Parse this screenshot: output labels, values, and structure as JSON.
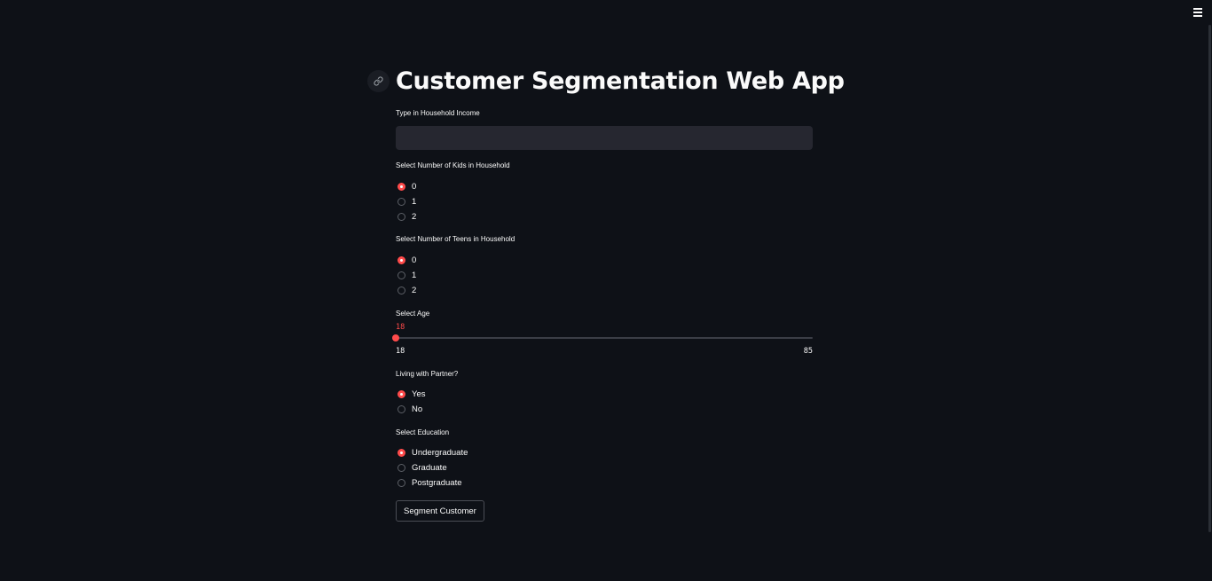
{
  "app": {
    "title": "Customer Segmentation Web App"
  },
  "icons": {
    "anchor": "link-icon",
    "menu": "hamburger-menu-icon"
  },
  "colors": {
    "background": "#0e1117",
    "accent": "#ff4b4b",
    "input_background": "#262730",
    "text": "#fafafa"
  },
  "income": {
    "label": "Type in Household Income",
    "value": "",
    "placeholder": ""
  },
  "kids": {
    "label": "Select Number of Kids in Household",
    "options": [
      "0",
      "1",
      "2"
    ],
    "selected": "0"
  },
  "teens": {
    "label": "Select Number of Teens in Household",
    "options": [
      "0",
      "1",
      "2"
    ],
    "selected": "0"
  },
  "age": {
    "label": "Select Age",
    "value": "18",
    "min": "18",
    "max": "85"
  },
  "partner": {
    "label": "Living with Partner?",
    "options": [
      "Yes",
      "No"
    ],
    "selected": "Yes"
  },
  "education": {
    "label": "Select Education",
    "options": [
      "Undergraduate",
      "Graduate",
      "Postgraduate"
    ],
    "selected": "Undergraduate"
  },
  "submit": {
    "label": "Segment Customer"
  }
}
